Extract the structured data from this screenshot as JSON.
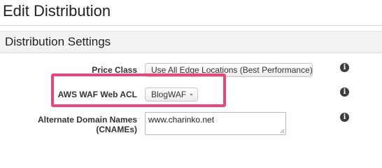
{
  "page": {
    "title": "Edit Distribution"
  },
  "section": {
    "title": "Distribution Settings"
  },
  "rows": {
    "price_class": {
      "label": "Price Class",
      "selected": "Use All Edge Locations (Best Performance)"
    },
    "waf": {
      "label": "AWS WAF Web ACL",
      "selected": "BlogWAF"
    },
    "cnames": {
      "label_line1": "Alternate Domain Names",
      "label_line2": "(CNAMEs)",
      "value": "www.charinko.net"
    }
  },
  "icons": {
    "info": "info-icon",
    "info_glyph": "i",
    "dropdown": "chevron-down-icon"
  },
  "colors": {
    "highlight": "#e8467c",
    "section_bg": "#f2f2f2"
  }
}
